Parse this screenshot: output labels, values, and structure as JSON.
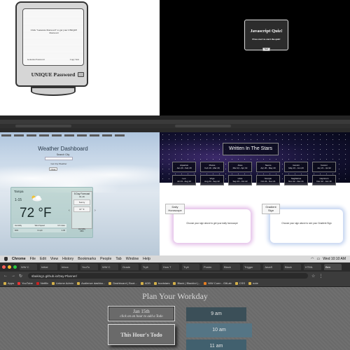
{
  "password_app": {
    "instruction": "Click \"Generate Password\" to get your UNIQUE Password",
    "field_label": "Generate Password",
    "copy_label": "Copy Text",
    "title": "UNIQUE Password"
  },
  "quiz_app": {
    "title": "Javascript Quiz!",
    "subtitle": "Press start to start the quiz!",
    "start_label": "Start"
  },
  "weather_app": {
    "heading": "Weather Dashboard",
    "search_label": "Search City",
    "submit_label": "Get City Weather",
    "clear_label": "Clear",
    "city": "Tampa",
    "date": "1-15",
    "temperature": "72 °F",
    "stat_headers": [
      "Humidity",
      "Wind Speed",
      "UV Index"
    ],
    "stat_values": [
      "66%",
      "6 mph",
      "4.05"
    ],
    "forecast_title": "5 Day Forecast",
    "forecast_date": "01-16",
    "forecast_condition": "Sunny",
    "forecast_temp": "67 °F",
    "forecast_humidity_label": "Humidity",
    "forecast_humidity": "96%",
    "prev": "‹",
    "next": "›"
  },
  "horoscope_app": {
    "title": "Written In The Stars",
    "signs": [
      {
        "name": "Aquarius",
        "dates": "Jan 20 - Feb 18"
      },
      {
        "name": "Pisces",
        "dates": "Feb 19 - Mar 20"
      },
      {
        "name": "Aries",
        "dates": "Mar 21 - Apr 19"
      },
      {
        "name": "Taurus",
        "dates": "Apr 20 - May 20"
      },
      {
        "name": "Gemini",
        "dates": "May 21 - Jun 20"
      },
      {
        "name": "Cancer",
        "dates": "Jun 21 - Jul 22"
      },
      {
        "name": "Leo",
        "dates": "Jul 23 - Aug 22"
      },
      {
        "name": "Virgo",
        "dates": "Aug 23 - Sep 22"
      },
      {
        "name": "Libra",
        "dates": "Sep 23 - Oct 22"
      },
      {
        "name": "Scorpio",
        "dates": "Oct 23 - Nov 21"
      },
      {
        "name": "Sagittarius",
        "dates": "Nov 22 - Dec 21"
      },
      {
        "name": "Capricorn",
        "dates": "Dec 22 - Jan 19"
      }
    ],
    "daily_tag": "Daily Horoscope",
    "daily_text": "Choose your sign above to get your daily horoscope",
    "gradient_tag": "Gradient Sign",
    "gradient_text": "Choose your sign above to see your Gradient Sign"
  },
  "planner_browser": {
    "menu": [
      "Chrome",
      "File",
      "Edit",
      "View",
      "History",
      "Bookmarks",
      "People",
      "Tab",
      "Window",
      "Help"
    ],
    "clock": "Wed 10:10 AM",
    "tabs": [
      "WW C",
      "Initial",
      "Inbox",
      "YouTu",
      "WW C",
      "Grade",
      "Tryit",
      "How T",
      "Tryit",
      "Postm",
      "Black",
      "Trigger",
      "JavaS",
      "Black",
      "HTML",
      "Ben"
    ],
    "url": "sbaking1.github.io/Day-Planner/",
    "bookmarks": [
      "Apps",
      "YouTube",
      "Netflix",
      "Linkme Admin",
      "Audience dashbo...",
      "Dashboard | Boot...",
      "ADB",
      "bootstars",
      "Black | Blackbd |...",
      "WW Coen - GitLab",
      "CSS",
      "note"
    ],
    "title": "Plan Your Workday",
    "date": "Jan 15th",
    "date_hint": "click on an hour to add a Todo",
    "todo_label": "This Hour's Todo",
    "hours": [
      "9 am",
      "10 am",
      "11 am"
    ]
  }
}
